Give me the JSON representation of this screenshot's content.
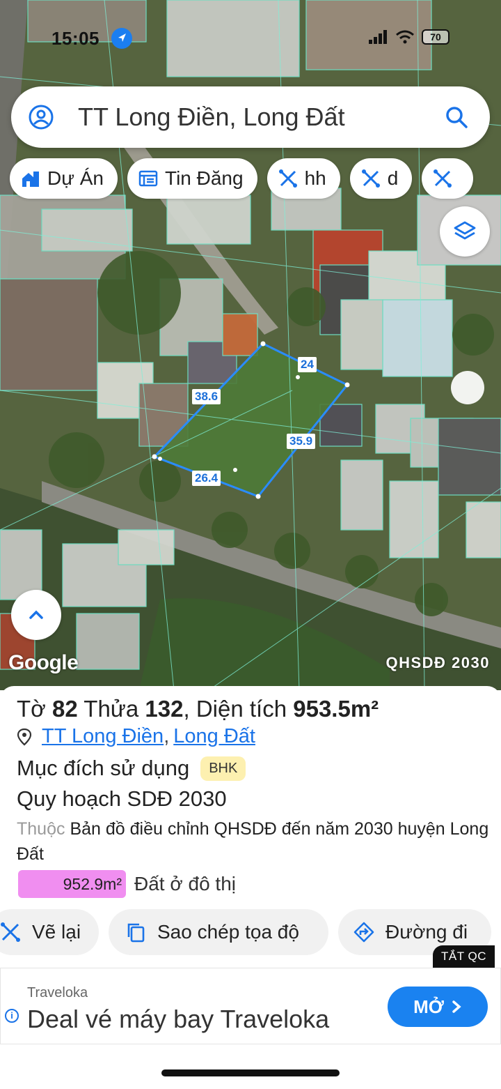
{
  "status_bar": {
    "time": "15:05",
    "battery": "70"
  },
  "search": {
    "text": "TT Long Điền, Long Đất"
  },
  "chips": [
    {
      "label": "Dự Án",
      "icon": "home-city-icon"
    },
    {
      "label": "Tin Đăng",
      "icon": "listing-icon"
    },
    {
      "label": "hh",
      "icon": "ruler-icon"
    },
    {
      "label": "d",
      "icon": "ruler-icon"
    },
    {
      "label": "",
      "icon": "ruler-icon"
    }
  ],
  "map": {
    "edges": [
      "24",
      "38.6",
      "35.9",
      "26.4"
    ],
    "attribution": "Google",
    "layer_label": "QHSDĐ 2030",
    "parcel_color": "#2a8cff"
  },
  "parcel": {
    "title_prefix": "Tờ",
    "sheet": "82",
    "plot_label": "Thửa",
    "plot": "132",
    "area_label": ", Diện tích",
    "area": "953.5m²",
    "address_town": "TT Long Điền",
    "address_separator": ",",
    "address_district": "Long Đất",
    "purpose_label": "Mục đích sử dụng",
    "purpose_code": "BHK",
    "plan_label": "Quy hoạch SDĐ 2030",
    "belongs_prefix": "Thuộc",
    "belongs_text": "Bản đồ điều chỉnh QHSDĐ đến năm 2030 huyện Long Đất",
    "zone_area": "952.9m²",
    "zone_label": "Đất ở đô thị",
    "zone_color": "#f08ef0"
  },
  "actions": {
    "redraw": "Vẽ lại",
    "copy_coords": "Sao chép tọa độ",
    "directions": "Đường đi"
  },
  "ad": {
    "off_label": "TẮT QC",
    "source": "Traveloka",
    "title": "Deal vé máy bay Traveloka",
    "cta": "MỞ"
  },
  "colors": {
    "accent": "#1a73e8",
    "cta": "#1a82f0"
  }
}
